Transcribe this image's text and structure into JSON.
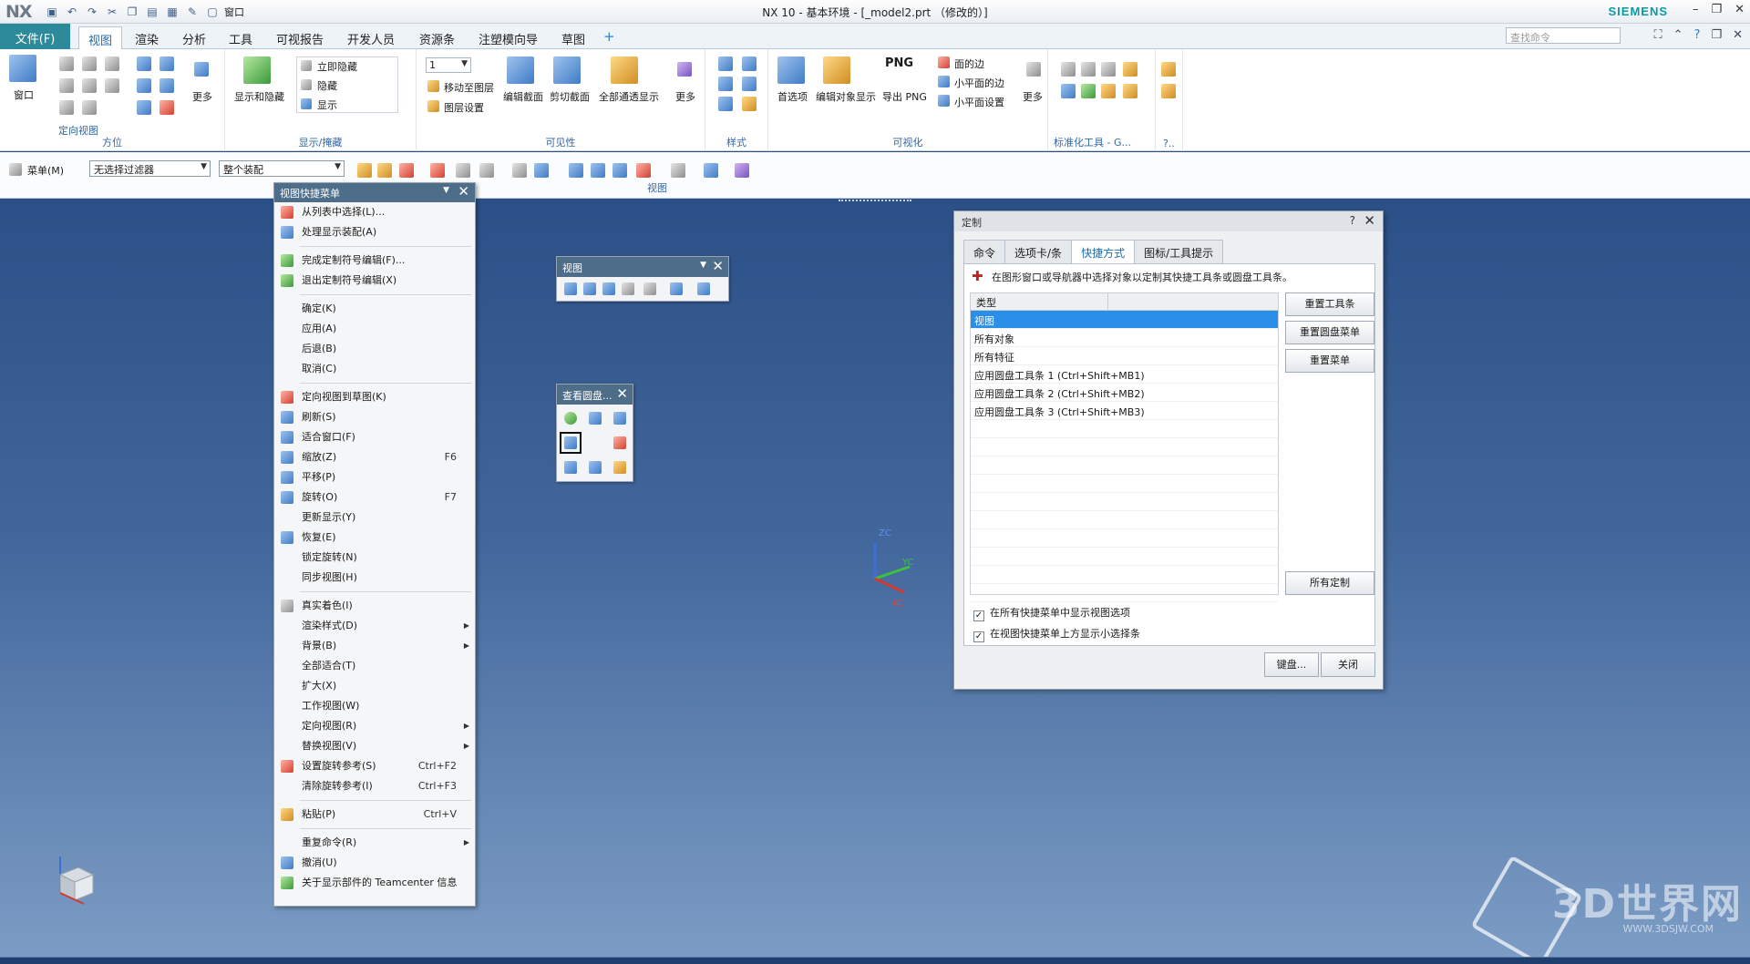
{
  "titlebar": {
    "logo": "NX",
    "title": "NX 10 - 基本环境 - [_model2.prt （修改的）]",
    "brand": "SIEMENS",
    "qat_window": "窗口"
  },
  "tabs": {
    "file": "文件(F)",
    "items": [
      "视图",
      "渲染",
      "分析",
      "工具",
      "可视报告",
      "开发人员",
      "资源条",
      "注塑模向导",
      "草图"
    ],
    "search_placeholder": "查找命令"
  },
  "ribbon": {
    "window_label": "窗口",
    "orient_view_label": "定向视图",
    "more": "更多",
    "orientation_group": "方位",
    "show_hide_label": "显示和隐藏",
    "immediate_hide": "立即隐藏",
    "hide": "隐藏",
    "show": "显示",
    "show_hide_group": "显示/掩藏",
    "layer_value": "1",
    "move_to_layer": "移动至图层",
    "layer_settings": "图层设置",
    "edit_section": "编辑截面",
    "clip_section": "剪切截面",
    "all_through_display": "全部通透显示",
    "visibility_group": "可见性",
    "style_group": "样式",
    "preferences": "首选项",
    "edit_object_display": "编辑对象显示",
    "export_png_top": "PNG",
    "export_png": "导出 PNG",
    "face_edges": "面的边",
    "small_plane_edges": "小平面的边",
    "small_plane_settings": "小平面设置",
    "visualization_group": "可视化",
    "standard_tools_group": "标准化工具 - G...",
    "extra_group": "?.."
  },
  "toolbar2": {
    "menu": "菜单(M)",
    "filter": "无选择过滤器",
    "assembly": "整个装配",
    "view_group": "视图"
  },
  "context_menu": {
    "title": "视图快捷菜单",
    "items": [
      {
        "label": "从列表中选择(L)...",
        "shortcut": "",
        "sub": false,
        "icon": "red"
      },
      {
        "label": "处理显示装配(A)",
        "shortcut": "",
        "sub": false,
        "icon": "blue"
      },
      {
        "sep": true
      },
      {
        "label": "完成定制符号编辑(F)...",
        "shortcut": "",
        "sub": false,
        "icon": "grn"
      },
      {
        "label": "退出定制符号编辑(X)",
        "shortcut": "",
        "sub": false,
        "icon": "grn"
      },
      {
        "sep": true
      },
      {
        "label": "确定(K)",
        "shortcut": "",
        "sub": false,
        "icon": ""
      },
      {
        "label": "应用(A)",
        "shortcut": "",
        "sub": false,
        "icon": ""
      },
      {
        "label": "后退(B)",
        "shortcut": "",
        "sub": false,
        "icon": ""
      },
      {
        "label": "取消(C)",
        "shortcut": "",
        "sub": false,
        "icon": ""
      },
      {
        "sep": true
      },
      {
        "label": "定向视图到草图(K)",
        "shortcut": "",
        "sub": false,
        "icon": "red"
      },
      {
        "label": "刷新(S)",
        "shortcut": "",
        "sub": false,
        "icon": "blue"
      },
      {
        "label": "适合窗口(F)",
        "shortcut": "",
        "sub": false,
        "icon": "blue"
      },
      {
        "label": "缩放(Z)",
        "shortcut": "F6",
        "sub": false,
        "icon": "blue"
      },
      {
        "label": "平移(P)",
        "shortcut": "",
        "sub": false,
        "icon": "blue"
      },
      {
        "label": "旋转(O)",
        "shortcut": "F7",
        "sub": false,
        "icon": "blue"
      },
      {
        "label": "更新显示(Y)",
        "shortcut": "",
        "sub": false,
        "icon": ""
      },
      {
        "label": "恢复(E)",
        "shortcut": "",
        "sub": false,
        "icon": "blue"
      },
      {
        "label": "锁定旋转(N)",
        "shortcut": "",
        "sub": false,
        "icon": ""
      },
      {
        "label": "同步视图(H)",
        "shortcut": "",
        "sub": false,
        "icon": ""
      },
      {
        "sep": true
      },
      {
        "label": "真实着色(I)",
        "shortcut": "",
        "sub": false,
        "icon": "gray"
      },
      {
        "label": "渲染样式(D)",
        "shortcut": "",
        "sub": true,
        "icon": ""
      },
      {
        "label": "背景(B)",
        "shortcut": "",
        "sub": true,
        "icon": ""
      },
      {
        "label": "全部适合(T)",
        "shortcut": "",
        "sub": false,
        "icon": ""
      },
      {
        "label": "扩大(X)",
        "shortcut": "",
        "sub": false,
        "icon": ""
      },
      {
        "label": "工作视图(W)",
        "shortcut": "",
        "sub": false,
        "icon": ""
      },
      {
        "label": "定向视图(R)",
        "shortcut": "",
        "sub": true,
        "icon": ""
      },
      {
        "label": "替换视图(V)",
        "shortcut": "",
        "sub": true,
        "icon": ""
      },
      {
        "label": "设置旋转参考(S)",
        "shortcut": "Ctrl+F2",
        "sub": false,
        "icon": "red"
      },
      {
        "label": "清除旋转参考(I)",
        "shortcut": "Ctrl+F3",
        "sub": false,
        "icon": ""
      },
      {
        "sep": true
      },
      {
        "label": "粘贴(P)",
        "shortcut": "Ctrl+V",
        "sub": false,
        "icon": "org"
      },
      {
        "sep": true
      },
      {
        "label": "重复命令(R)",
        "shortcut": "",
        "sub": true,
        "icon": ""
      },
      {
        "label": "撤消(U)",
        "shortcut": "",
        "sub": false,
        "icon": "blue"
      },
      {
        "label": "关于显示部件的 Teamcenter 信息",
        "shortcut": "",
        "sub": false,
        "icon": "grn"
      }
    ]
  },
  "view_toolbar": {
    "title": "视图"
  },
  "orbit_toolbar": {
    "title": "查看圆盘..."
  },
  "dialog": {
    "title": "定制",
    "help": "?",
    "tabs": [
      "命令",
      "选项卡/条",
      "快捷方式",
      "图标/工具提示"
    ],
    "active_tab": 2,
    "hint": "在图形窗口或导航器中选择对象以定制其快捷工具条或圆盘工具条。",
    "list_header": "类型",
    "rows": [
      "视图",
      "所有对象",
      "所有特征",
      "应用圆盘工具条 1 (Ctrl+Shift+MB1)",
      "应用圆盘工具条 2 (Ctrl+Shift+MB2)",
      "应用圆盘工具条 3 (Ctrl+Shift+MB3)"
    ],
    "selected_row": 0,
    "btn_reset_toolbar": "重置工具条",
    "btn_reset_radial": "重置圆盘菜单",
    "btn_reset_menu": "重置菜单",
    "btn_all_custom": "所有定制",
    "chk_show_view_options": "在所有快捷菜单中显示视图选项",
    "chk_show_mini_bar": "在视图快捷菜单上方显示小选择条",
    "btn_keyboard": "键盘...",
    "btn_close": "关闭"
  },
  "triad": {
    "zc": "ZC",
    "yc": "YC",
    "xc": "XC"
  },
  "watermark": {
    "text": "3D世界网",
    "url": "WWW.3DSJW.COM"
  },
  "icons": [
    "save-icon",
    "undo-icon",
    "redo-icon",
    "close-icon",
    "submenu-arrow-icon",
    "dropdown-arrow-icon",
    "help-icon",
    "search-icon"
  ]
}
